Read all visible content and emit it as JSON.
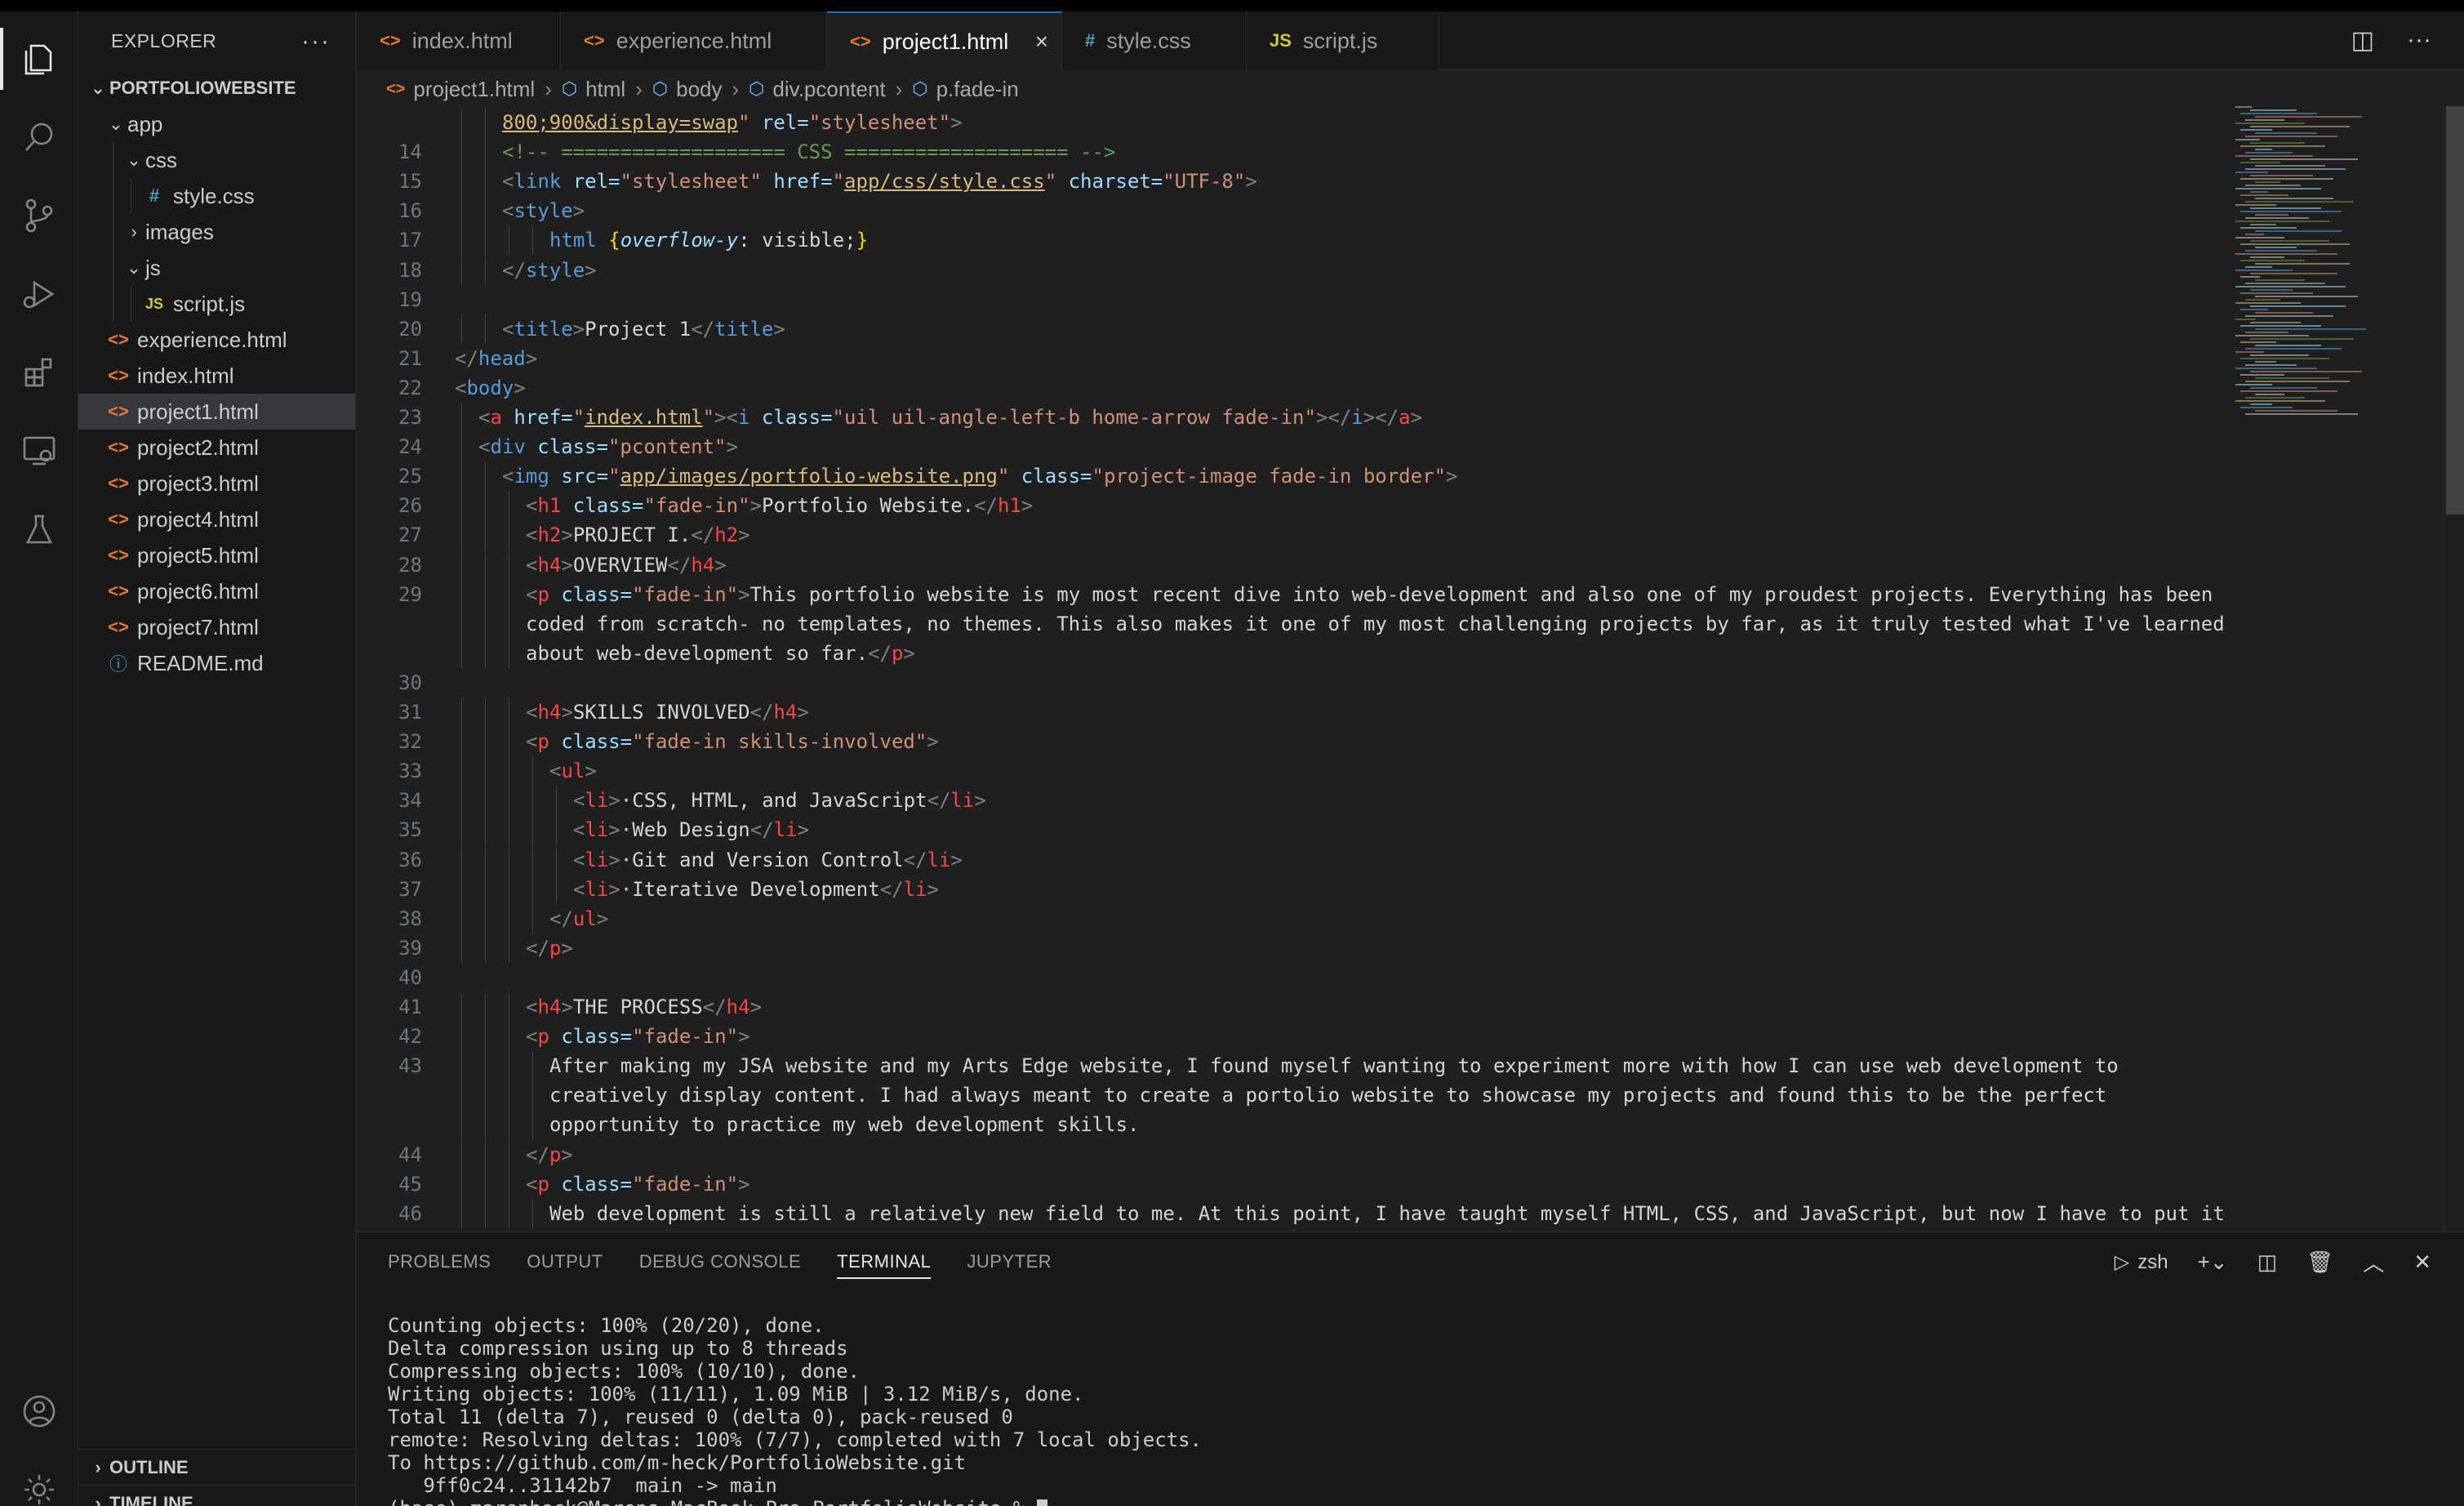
{
  "sidebar": {
    "title": "EXPLORER",
    "more": "···",
    "project": "PORTFOLIOWEBSITE",
    "tree": [
      {
        "label": "app",
        "type": "folder",
        "depth": 1,
        "expanded": true
      },
      {
        "label": "css",
        "type": "folder",
        "depth": 2,
        "expanded": true
      },
      {
        "label": "style.css",
        "type": "css",
        "depth": 3
      },
      {
        "label": "images",
        "type": "folder",
        "depth": 2,
        "expanded": false
      },
      {
        "label": "js",
        "type": "folder",
        "depth": 2,
        "expanded": true
      },
      {
        "label": "script.js",
        "type": "js",
        "depth": 3
      },
      {
        "label": "experience.html",
        "type": "html",
        "depth": 1
      },
      {
        "label": "index.html",
        "type": "html",
        "depth": 1
      },
      {
        "label": "project1.html",
        "type": "html",
        "depth": 1,
        "selected": true
      },
      {
        "label": "project2.html",
        "type": "html",
        "depth": 1
      },
      {
        "label": "project3.html",
        "type": "html",
        "depth": 1
      },
      {
        "label": "project4.html",
        "type": "html",
        "depth": 1
      },
      {
        "label": "project5.html",
        "type": "html",
        "depth": 1
      },
      {
        "label": "project6.html",
        "type": "html",
        "depth": 1
      },
      {
        "label": "project7.html",
        "type": "html",
        "depth": 1
      },
      {
        "label": "README.md",
        "type": "info",
        "depth": 1
      }
    ],
    "outline": "OUTLINE",
    "timeline": "TIMELINE"
  },
  "tabs": [
    {
      "label": "index.html",
      "icon": "<>",
      "type": "html"
    },
    {
      "label": "experience.html",
      "icon": "<>",
      "type": "html"
    },
    {
      "label": "project1.html",
      "icon": "<>",
      "type": "html",
      "active": true
    },
    {
      "label": "style.css",
      "icon": "#",
      "type": "css"
    },
    {
      "label": "script.js",
      "icon": "JS",
      "type": "js"
    }
  ],
  "breadcrumb": [
    "project1.html",
    "html",
    "body",
    "div.pcontent",
    "p.fade-in"
  ],
  "editor": {
    "lines": [
      {
        "n": "",
        "indent": 2,
        "segs": [
          [
            "strl",
            "800;900&display=swap"
          ],
          [
            "str",
            "\""
          ],
          [
            "at",
            " rel="
          ],
          [
            "str",
            "\"stylesheet\""
          ],
          [
            "t",
            ">"
          ]
        ]
      },
      {
        "n": "14",
        "indent": 2,
        "segs": [
          [
            "cm",
            "<!-- =================== CSS =================== -->"
          ]
        ]
      },
      {
        "n": "15",
        "indent": 2,
        "segs": [
          [
            "t",
            "<"
          ],
          [
            "tag",
            "link"
          ],
          [
            "at",
            " rel="
          ],
          [
            "str",
            "\"stylesheet\""
          ],
          [
            "at",
            " href="
          ],
          [
            "str",
            "\""
          ],
          [
            "strl",
            "app/css/style.css"
          ],
          [
            "str",
            "\""
          ],
          [
            "at",
            " charset="
          ],
          [
            "str",
            "\"UTF-8\""
          ],
          [
            "t",
            ">"
          ]
        ]
      },
      {
        "n": "16",
        "indent": 2,
        "segs": [
          [
            "t",
            "<"
          ],
          [
            "tag",
            "style"
          ],
          [
            "t",
            ">"
          ]
        ]
      },
      {
        "n": "17",
        "indent": 4,
        "segs": [
          [
            "tag",
            "html "
          ],
          [
            "brace",
            "{"
          ],
          [
            "prop",
            "overflow-y"
          ],
          [
            "txt",
            ": visible;"
          ],
          [
            "brace",
            "}"
          ]
        ]
      },
      {
        "n": "18",
        "indent": 2,
        "segs": [
          [
            "t",
            "</"
          ],
          [
            "tag",
            "style"
          ],
          [
            "t",
            ">"
          ]
        ]
      },
      {
        "n": "19",
        "indent": 0,
        "segs": []
      },
      {
        "n": "20",
        "indent": 2,
        "segs": [
          [
            "t",
            "<"
          ],
          [
            "tag",
            "title"
          ],
          [
            "t",
            ">"
          ],
          [
            "txt",
            "Project 1"
          ],
          [
            "t",
            "</"
          ],
          [
            "tag",
            "title"
          ],
          [
            "t",
            ">"
          ]
        ]
      },
      {
        "n": "21",
        "indent": 0,
        "segs": [
          [
            "t",
            "</"
          ],
          [
            "tag",
            "head"
          ],
          [
            "t",
            ">"
          ]
        ]
      },
      {
        "n": "22",
        "indent": 0,
        "segs": [
          [
            "t",
            "<"
          ],
          [
            "tag",
            "body"
          ],
          [
            "t",
            ">"
          ]
        ]
      },
      {
        "n": "23",
        "indent": 1,
        "segs": [
          [
            "t",
            "<"
          ],
          [
            "tagr",
            "a"
          ],
          [
            "at",
            " href="
          ],
          [
            "str",
            "\""
          ],
          [
            "strl",
            "index.html"
          ],
          [
            "str",
            "\""
          ],
          [
            "t",
            ">"
          ],
          [
            "t",
            "<"
          ],
          [
            "tag",
            "i"
          ],
          [
            "at",
            " class="
          ],
          [
            "str",
            "\"uil uil-angle-left-b home-arrow fade-in\""
          ],
          [
            "t",
            "></"
          ],
          [
            "tag",
            "i"
          ],
          [
            "t",
            "></"
          ],
          [
            "tagr",
            "a"
          ],
          [
            "t",
            ">"
          ]
        ]
      },
      {
        "n": "24",
        "indent": 1,
        "segs": [
          [
            "t",
            "<"
          ],
          [
            "tag",
            "div"
          ],
          [
            "at",
            " class="
          ],
          [
            "str",
            "\"pcontent\""
          ],
          [
            "t",
            ">"
          ]
        ]
      },
      {
        "n": "25",
        "indent": 2,
        "segs": [
          [
            "t",
            "<"
          ],
          [
            "tag",
            "img"
          ],
          [
            "at",
            " src="
          ],
          [
            "str",
            "\""
          ],
          [
            "strl",
            "app/images/portfolio-website.png"
          ],
          [
            "str",
            "\""
          ],
          [
            "at",
            " class="
          ],
          [
            "str",
            "\"project-image fade-in border\""
          ],
          [
            "t",
            ">"
          ]
        ]
      },
      {
        "n": "26",
        "indent": 3,
        "segs": [
          [
            "t",
            "<"
          ],
          [
            "tagr",
            "h1"
          ],
          [
            "at",
            " class="
          ],
          [
            "str",
            "\"fade-in\""
          ],
          [
            "t",
            ">"
          ],
          [
            "txt",
            "Portfolio Website."
          ],
          [
            "t",
            "</"
          ],
          [
            "tagr",
            "h1"
          ],
          [
            "t",
            ">"
          ]
        ]
      },
      {
        "n": "27",
        "indent": 3,
        "segs": [
          [
            "t",
            "<"
          ],
          [
            "tagr",
            "h2"
          ],
          [
            "t",
            ">"
          ],
          [
            "txt",
            "PROJECT I."
          ],
          [
            "t",
            "</"
          ],
          [
            "tagr",
            "h2"
          ],
          [
            "t",
            ">"
          ]
        ]
      },
      {
        "n": "28",
        "indent": 3,
        "segs": [
          [
            "t",
            "<"
          ],
          [
            "tagr",
            "h4"
          ],
          [
            "t",
            ">"
          ],
          [
            "txt",
            "OVERVIEW"
          ],
          [
            "t",
            "</"
          ],
          [
            "tagr",
            "h4"
          ],
          [
            "t",
            ">"
          ]
        ]
      },
      {
        "n": "29",
        "indent": 3,
        "segs": [
          [
            "t",
            "<"
          ],
          [
            "tagr",
            "p"
          ],
          [
            "at",
            " class="
          ],
          [
            "str",
            "\"fade-in\""
          ],
          [
            "t",
            ">"
          ],
          [
            "txt",
            "This portfolio website is my most recent dive into web-development and also one of my proudest projects. Everything has been"
          ]
        ]
      },
      {
        "n": "",
        "indent": 3,
        "segs": [
          [
            "txt",
            "coded from scratch- no templates, no themes. This also makes it one of my most challenging projects by far, as it truly tested what I've learned"
          ]
        ]
      },
      {
        "n": "",
        "indent": 3,
        "segs": [
          [
            "txt",
            "about web-development so far."
          ],
          [
            "t",
            "</"
          ],
          [
            "tagr",
            "p"
          ],
          [
            "t",
            ">"
          ]
        ]
      },
      {
        "n": "30",
        "indent": 0,
        "segs": []
      },
      {
        "n": "31",
        "indent": 3,
        "segs": [
          [
            "t",
            "<"
          ],
          [
            "tagr",
            "h4"
          ],
          [
            "t",
            ">"
          ],
          [
            "txt",
            "SKILLS INVOLVED"
          ],
          [
            "t",
            "</"
          ],
          [
            "tagr",
            "h4"
          ],
          [
            "t",
            ">"
          ]
        ]
      },
      {
        "n": "32",
        "indent": 3,
        "segs": [
          [
            "t",
            "<"
          ],
          [
            "tagr",
            "p"
          ],
          [
            "at",
            " class="
          ],
          [
            "str",
            "\"fade-in skills-involved\""
          ],
          [
            "t",
            ">"
          ]
        ]
      },
      {
        "n": "33",
        "indent": 4,
        "segs": [
          [
            "t",
            "<"
          ],
          [
            "tagr",
            "ul"
          ],
          [
            "t",
            ">"
          ]
        ]
      },
      {
        "n": "34",
        "indent": 5,
        "segs": [
          [
            "t",
            "<"
          ],
          [
            "tagr",
            "li"
          ],
          [
            "t",
            ">"
          ],
          [
            "txt",
            "·CSS, HTML, and JavaScript"
          ],
          [
            "t",
            "</"
          ],
          [
            "tagr",
            "li"
          ],
          [
            "t",
            ">"
          ]
        ]
      },
      {
        "n": "35",
        "indent": 5,
        "segs": [
          [
            "t",
            "<"
          ],
          [
            "tagr",
            "li"
          ],
          [
            "t",
            ">"
          ],
          [
            "txt",
            "·Web Design"
          ],
          [
            "t",
            "</"
          ],
          [
            "tagr",
            "li"
          ],
          [
            "t",
            ">"
          ]
        ]
      },
      {
        "n": "36",
        "indent": 5,
        "segs": [
          [
            "t",
            "<"
          ],
          [
            "tagr",
            "li"
          ],
          [
            "t",
            ">"
          ],
          [
            "txt",
            "·Git and Version Control"
          ],
          [
            "t",
            "</"
          ],
          [
            "tagr",
            "li"
          ],
          [
            "t",
            ">"
          ]
        ]
      },
      {
        "n": "37",
        "indent": 5,
        "segs": [
          [
            "t",
            "<"
          ],
          [
            "tagr",
            "li"
          ],
          [
            "t",
            ">"
          ],
          [
            "txt",
            "·Iterative Development"
          ],
          [
            "t",
            "</"
          ],
          [
            "tagr",
            "li"
          ],
          [
            "t",
            ">"
          ]
        ]
      },
      {
        "n": "38",
        "indent": 4,
        "segs": [
          [
            "t",
            "</"
          ],
          [
            "tagr",
            "ul"
          ],
          [
            "t",
            ">"
          ]
        ]
      },
      {
        "n": "39",
        "indent": 3,
        "segs": [
          [
            "t",
            "</"
          ],
          [
            "tagr",
            "p"
          ],
          [
            "t",
            ">"
          ]
        ]
      },
      {
        "n": "40",
        "indent": 0,
        "segs": []
      },
      {
        "n": "41",
        "indent": 3,
        "segs": [
          [
            "t",
            "<"
          ],
          [
            "tagr",
            "h4"
          ],
          [
            "t",
            ">"
          ],
          [
            "txt",
            "THE PROCESS"
          ],
          [
            "t",
            "</"
          ],
          [
            "tagr",
            "h4"
          ],
          [
            "t",
            ">"
          ]
        ]
      },
      {
        "n": "42",
        "indent": 3,
        "segs": [
          [
            "t",
            "<"
          ],
          [
            "tagr",
            "p"
          ],
          [
            "at",
            " class="
          ],
          [
            "str",
            "\"fade-in\""
          ],
          [
            "t",
            ">"
          ]
        ]
      },
      {
        "n": "43",
        "indent": 4,
        "segs": [
          [
            "txt",
            "After making my JSA website and my Arts Edge website, I found myself wanting to experiment more with how I can use web development to"
          ]
        ]
      },
      {
        "n": "",
        "indent": 4,
        "segs": [
          [
            "txt",
            "creatively display content. I had always meant to create a portolio website to showcase my projects and found this to be the perfect"
          ]
        ]
      },
      {
        "n": "",
        "indent": 4,
        "segs": [
          [
            "txt",
            "opportunity to practice my web development skills."
          ]
        ]
      },
      {
        "n": "44",
        "indent": 3,
        "segs": [
          [
            "t",
            "</"
          ],
          [
            "tagr",
            "p"
          ],
          [
            "t",
            ">"
          ]
        ]
      },
      {
        "n": "45",
        "indent": 3,
        "segs": [
          [
            "t",
            "<"
          ],
          [
            "tagr",
            "p"
          ],
          [
            "at",
            " class="
          ],
          [
            "str",
            "\"fade-in\""
          ],
          [
            "t",
            ">"
          ]
        ]
      },
      {
        "n": "46",
        "indent": 4,
        "segs": [
          [
            "txt",
            "Web development is still a relatively new field to me. At this point, I have taught myself HTML, CSS, and JavaScript, but now I have to put it"
          ]
        ]
      }
    ]
  },
  "panel": {
    "tabs": [
      "PROBLEMS",
      "OUTPUT",
      "DEBUG CONSOLE",
      "TERMINAL",
      "JUPYTER"
    ],
    "active_tab": "TERMINAL",
    "shell": "zsh",
    "terminal_lines": [
      "Counting objects: 100% (20/20), done.",
      "Delta compression using up to 8 threads",
      "Compressing objects: 100% (10/10), done.",
      "Writing objects: 100% (11/11), 1.09 MiB | 3.12 MiB/s, done.",
      "Total 11 (delta 7), reused 0 (delta 0), pack-reused 0",
      "remote: Resolving deltas: 100% (7/7), completed with 7 local objects.",
      "To https://github.com/m-heck/PortfolioWebsite.git",
      "   9ff0c24..31142b7  main -> main",
      "(base) marenheck@Marens-MacBook-Pro PortfolioWebsite % "
    ]
  }
}
